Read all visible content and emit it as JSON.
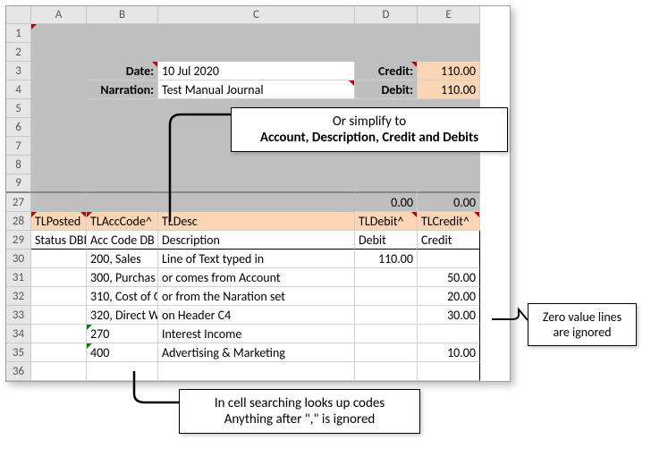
{
  "columns": [
    "A",
    "B",
    "C",
    "D",
    "E"
  ],
  "visibleRows": [
    "1",
    "2",
    "3",
    "4",
    "5",
    "6",
    "7",
    "8",
    "9",
    "27",
    "28",
    "29",
    "30",
    "31",
    "32",
    "33",
    "34",
    "35",
    "36"
  ],
  "header": {
    "dateLabel": "Date:",
    "dateValue": "10 Jul 2020",
    "narrationLabel": "Narration:",
    "narrationValue": "Test Manual Journal",
    "creditLabel": "Credit:",
    "creditValue": "110.00",
    "debitLabel": "Debit:",
    "debitValue": "110.00"
  },
  "row27": {
    "d": "0.00",
    "e": "0.00"
  },
  "row28": {
    "a": "TLPosted",
    "b": "TLAccCode^",
    "c": "TLDesc",
    "d": "TLDebit^",
    "e": "TLCredit^"
  },
  "row29": {
    "a": "Status DBI",
    "b": "Acc Code DB",
    "c": "Description",
    "d": "Debit",
    "e": "Credit"
  },
  "rows": [
    {
      "n": "30",
      "a": "",
      "b": "200, Sales",
      "c": "Line of Text typed in",
      "d": "110.00",
      "e": ""
    },
    {
      "n": "31",
      "a": "",
      "b": "300, Purchas",
      "c": "or comes from Account",
      "d": "",
      "e": "50.00"
    },
    {
      "n": "32",
      "a": "",
      "b": "310, Cost of G",
      "c": "or from the Naration set",
      "d": "",
      "e": "20.00"
    },
    {
      "n": "33",
      "a": "",
      "b": "320, Direct W",
      "c": "on Header C4",
      "d": "",
      "e": "30.00"
    },
    {
      "n": "34",
      "a": "",
      "b": "270",
      "c": "Interest Income",
      "d": "",
      "e": "",
      "green": true
    },
    {
      "n": "35",
      "a": "",
      "b": "400",
      "c": "Advertising & Marketing",
      "d": "",
      "e": "10.00",
      "green": true
    },
    {
      "n": "36",
      "a": "",
      "b": "",
      "c": "",
      "d": "",
      "e": ""
    }
  ],
  "callouts": {
    "top1": "Or simplify to",
    "top2": "Account, Description, Credit and Debits",
    "right1": "Zero value lines",
    "right2": "are ignored",
    "bottom1": "In cell searching looks up codes",
    "bottom2": "Anything after \",\" is ignored"
  }
}
